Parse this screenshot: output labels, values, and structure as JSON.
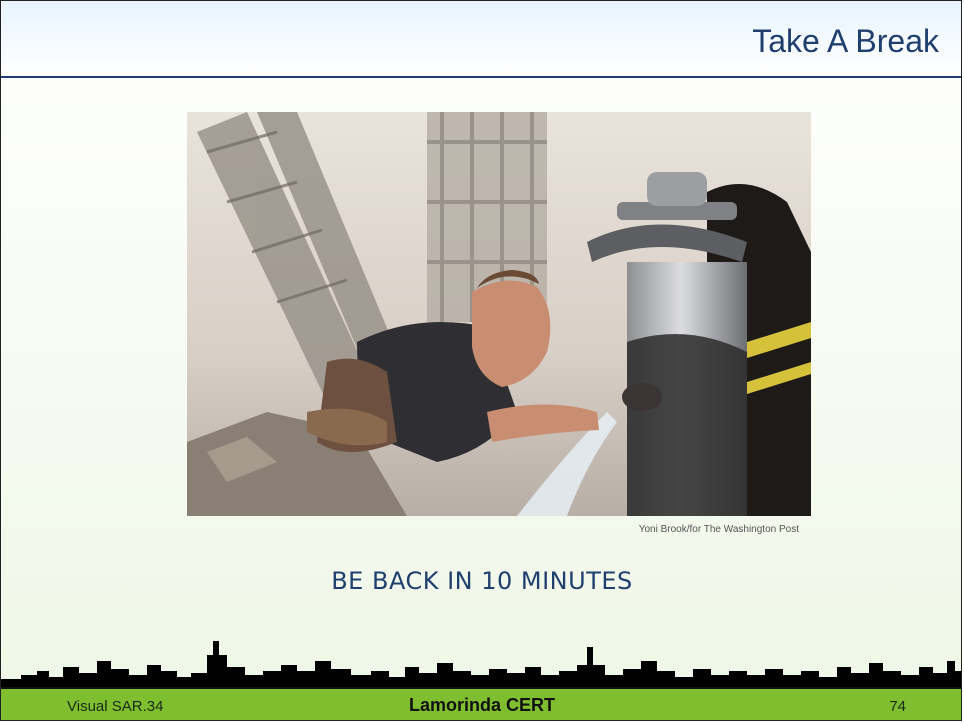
{
  "slide": {
    "title": "Take A Break",
    "photo_credit": "Yoni Brook/for The Washington Post",
    "subtitle": "BE BACK IN 10 MINUTES"
  },
  "footer": {
    "left": "Visual SAR.34",
    "center": "Lamorinda CERT",
    "page_number": "74"
  },
  "photo": {
    "subject": "firefighter-drinking-from-hydrant"
  },
  "colors": {
    "title": "#1f3f6e",
    "footer_bar": "#7fbf2f",
    "skyline": "#000000"
  }
}
